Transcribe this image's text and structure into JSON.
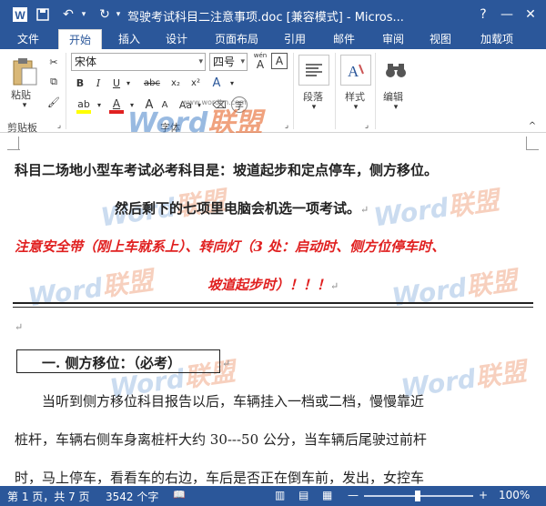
{
  "window": {
    "title": "驾驶考试科目二注意事项.doc [兼容模式] - Micros...",
    "help_glyph": "?",
    "minimize_glyph": "—",
    "close_glyph": "✕"
  },
  "tabs": [
    {
      "label": "文件"
    },
    {
      "label": "开始"
    },
    {
      "label": "插入"
    },
    {
      "label": "设计"
    },
    {
      "label": "页面布局"
    },
    {
      "label": "引用"
    },
    {
      "label": "邮件"
    },
    {
      "label": "审阅"
    },
    {
      "label": "视图"
    },
    {
      "label": "加载项"
    }
  ],
  "ribbon": {
    "paste_label": "粘贴",
    "clipboard_group": "剪贴板",
    "font_name": "宋体",
    "font_size": "四号",
    "font_group": "字体",
    "paragraph_label": "段落",
    "styles_label": "样式",
    "editing_label": "编辑",
    "bold": "B",
    "italic": "I",
    "underline": "U",
    "strike": "abc",
    "subscript": "x₂",
    "superscript": "x²",
    "grow_font": "A",
    "shrink_font": "A",
    "font_color": "A",
    "font_a": "A",
    "phonetic": "wén",
    "phonetic_a": "A",
    "border_a": "A",
    "aa": "Aa"
  },
  "watermark": {
    "word": "Word",
    "brand": "联盟",
    "url": "www.wordlm.com"
  },
  "document": {
    "line1": "科目二场地小型车考试必考科目是：坡道起步和定点停车，侧方移位。",
    "line2": "然后剩下的七项里电脑会机选一项考试。",
    "line3a": "注意安全带（刚上车就系上）",
    "line3b": "、转向灯（3 处：启动时、侧方位停车时、",
    "line4": "坡道起步时）！！！",
    "heading": "一. 侧方移位：（必考）",
    "body1": "当听到侧方移位科目报告以后，车辆挂入一档或二档，慢慢靠近",
    "body2": "桩杆，车辆右侧车身离桩杆大约 30---50 公分，当车辆后尾驶过前杆",
    "body3": "时，马上停车，看看车的右边，车后是否正在倒车前，发出，女控车",
    "para_mark": "↵"
  },
  "status": {
    "page": "第 1 页，共 7 页",
    "words": "3542 个字",
    "zoom": "100%",
    "zoom_minus": "—",
    "zoom_plus": "+"
  }
}
